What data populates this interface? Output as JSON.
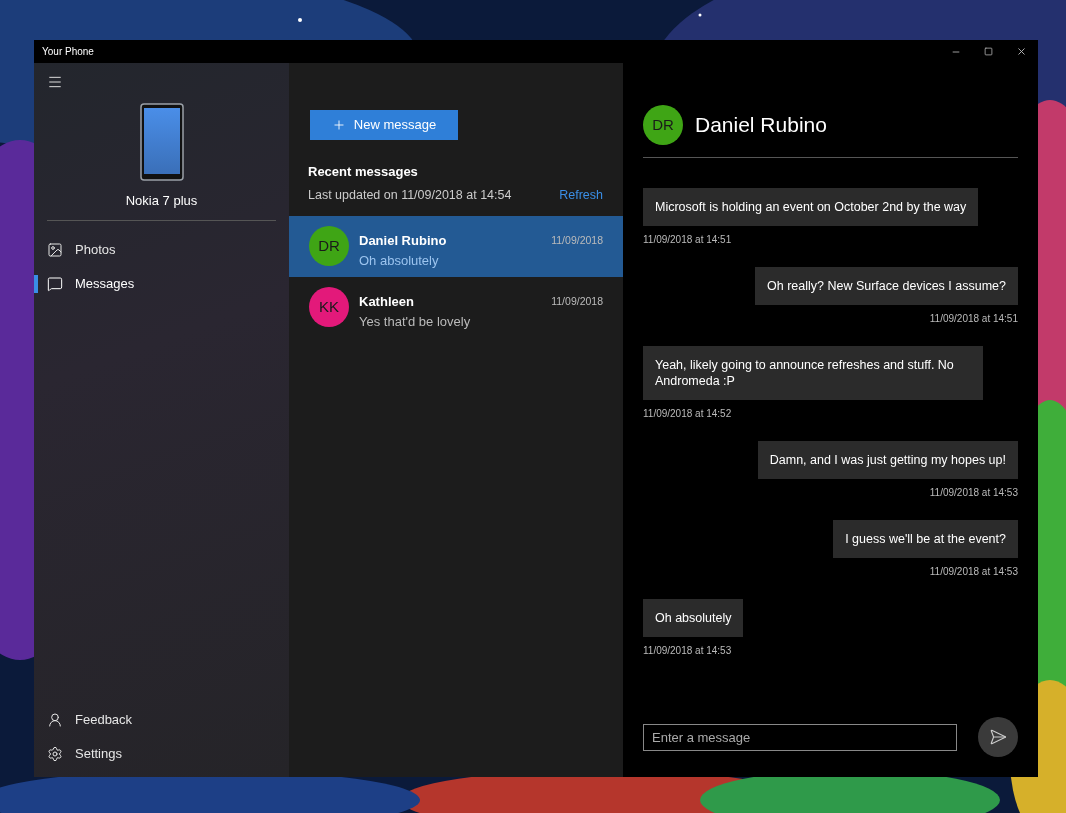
{
  "window": {
    "title": "Your Phone"
  },
  "sidebar": {
    "device": "Nokia 7 plus",
    "items": [
      {
        "label": "Photos",
        "kind": "photos",
        "selected": false
      },
      {
        "label": "Messages",
        "kind": "messages",
        "selected": true
      }
    ],
    "footer": [
      {
        "label": "Feedback",
        "kind": "feedback"
      },
      {
        "label": "Settings",
        "kind": "settings"
      }
    ]
  },
  "conversations": {
    "new_button": "New message",
    "heading": "Recent messages",
    "updated": "Last updated on 11/09/2018 at 14:54",
    "refresh": "Refresh",
    "items": [
      {
        "initials": "DR",
        "name": "Daniel Rubino",
        "preview": "Oh absolutely",
        "date": "11/09/2018",
        "color": "#3fa515",
        "selected": true
      },
      {
        "initials": "KK",
        "name": "Kathleen",
        "preview": "Yes that'd be lovely",
        "date": "11/09/2018",
        "color": "#e3197a",
        "selected": false
      }
    ]
  },
  "chat": {
    "initials": "DR",
    "name": "Daniel Rubino",
    "color": "#3fa515",
    "messages": [
      {
        "kind": "incoming",
        "text": "Microsoft is holding an event on October 2nd by the way",
        "time": "11/09/2018 at 14:51"
      },
      {
        "kind": "outgoing",
        "text": "Oh really? New Surface devices I assume?",
        "time": "11/09/2018 at 14:51"
      },
      {
        "kind": "incoming",
        "text": "Yeah, likely going to announce refreshes and stuff. No Andromeda :P",
        "time": "11/09/2018 at 14:52"
      },
      {
        "kind": "outgoing",
        "text": "Damn, and I was just getting my hopes up!",
        "time": "11/09/2018 at 14:53"
      },
      {
        "kind": "outgoing",
        "text": "I guess we'll be at the event?",
        "time": "11/09/2018 at 14:53"
      },
      {
        "kind": "incoming",
        "text": "Oh absolutely",
        "time": "11/09/2018 at 14:53"
      }
    ],
    "input": {
      "placeholder": "Enter a message"
    }
  }
}
